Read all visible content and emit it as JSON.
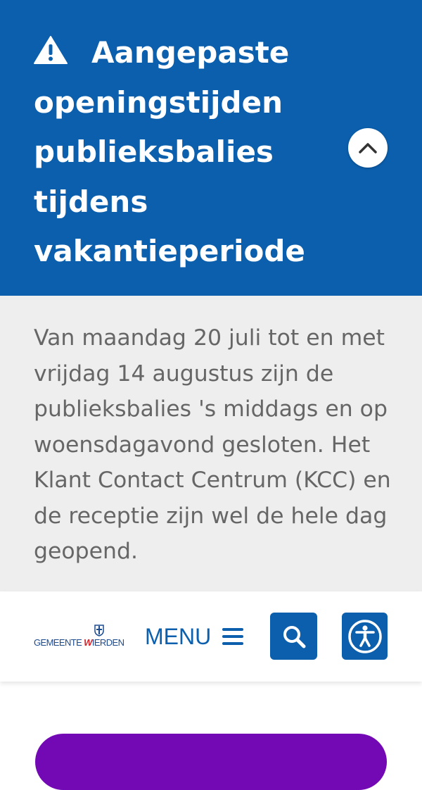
{
  "alert": {
    "title": "Aangepaste openingstijden publieksbalies tij­dens vakantieperiode",
    "body": "Van maandag 20 juli tot en met vrijdag 14 augustus zijn de publieksbalies 's middags en op woensdagavond gesloten. Het Klant Contact Centrum (KCC) en de receptie zijn wel de hele dag geopend.",
    "icon": "warning-icon",
    "collapse_icon": "chevron-up-icon",
    "background_color": "#0b5fad",
    "body_background_color": "#eeeeee"
  },
  "header": {
    "logo": {
      "text_a": "GEMEENTE ",
      "text_w": "W",
      "text_b": "IERDEN"
    },
    "menu_label": "MENU",
    "menu_icon": "hamburger-icon",
    "search_icon": "search-icon",
    "accessibility_icon": "accessibility-icon",
    "brand_color": "#0b5fad",
    "accent_color": "#7308b5"
  }
}
